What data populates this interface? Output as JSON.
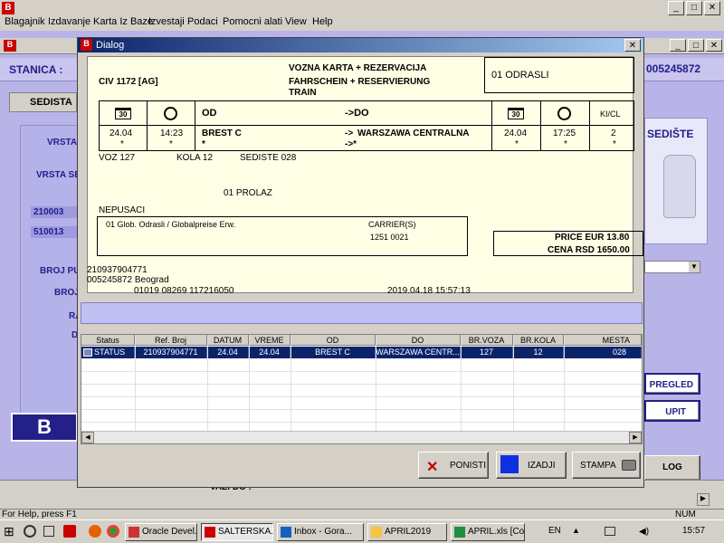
{
  "menu": [
    "Blagajnik",
    "Izdavanje",
    "Karta Iz Baze",
    "Izvestaji",
    "Podaci",
    "Pomocni alati",
    "View",
    "Help"
  ],
  "background": {
    "stanica_label": "STANICA :",
    "number": "005245872",
    "sedista_tab": "SEDISTA",
    "labels": [
      "VRSTA",
      "VRSTA SE",
      "210003",
      "510013",
      "BROJ PUT",
      "BROJ",
      "RA",
      "D"
    ],
    "sediste_title": "SEDIŠTE",
    "pregled_btn": "PREGLED",
    "upit_btn": "UPIT",
    "log_btn": "LOG",
    "vazi_do": "VAZI DO :",
    "num": "NUM",
    "status_bar": "For Help, press F1"
  },
  "dialog": {
    "title": "Dialog",
    "ticket": {
      "train_code": "CIV 1172 [AG]",
      "title1": "VOZNA KARTA + REZERVACIJA",
      "title2": "FAHRSCHEIN + RESERVIERUNG",
      "title3": "TRAIN",
      "passengers": "01 ODRASLI",
      "cal_icon_text": "30",
      "od_label": "OD",
      "do_label": "->DO",
      "kl_label": "KI/CL",
      "date1": "24.04",
      "time1": "14:23",
      "from": "BREST C",
      "to_prefix": "->",
      "to": "WARSZAWA CENTRALNA",
      "date2": "24.04",
      "time2": "17:25",
      "class": "2",
      "star": "*",
      "star_bold": "*",
      "arrow_star": "->*",
      "voz": "VOZ 127",
      "kola": "KOLA 12",
      "sediste": "SEDISTE 028",
      "prolaz": "01 PROLAZ",
      "nepusaci": "NEPUSACI",
      "tariff": "01 Glob. Odrasli / Globalpreise Erw.",
      "carrier_label": "CARRIER(S)",
      "carrier_code": "1251 0021",
      "price_eur": "PRICE EUR 13.80",
      "price_rsd": "CENA RSD  1650.00",
      "ref": "210937904771",
      "agent": "005245872  Beograd",
      "codes": "01019 08269 117216050",
      "issued": "2019.04.18 15:57:13"
    },
    "grid": {
      "headers": [
        "Status",
        "Ref. Broj",
        "DATUM",
        "VREME",
        "OD",
        "DO",
        "BR.VOZA",
        "BR.KOLA",
        "MESTA"
      ],
      "row": [
        "STATUS",
        "210937904771",
        "24.04",
        "24.04",
        "BREST C",
        "WARSZAWA CENTR...",
        "127",
        "12",
        "028"
      ]
    },
    "buttons": {
      "ponisti": "PONISTI",
      "izadji": "IZADJI",
      "stampa": "STAMPA"
    }
  },
  "taskbar": {
    "items": [
      "Oracle Devel...",
      "SALTERSKA...",
      "Inbox - Gora...",
      "APRIL2019",
      "APRIL.xls [Co..."
    ],
    "lang": "EN",
    "clock": "15:57"
  }
}
